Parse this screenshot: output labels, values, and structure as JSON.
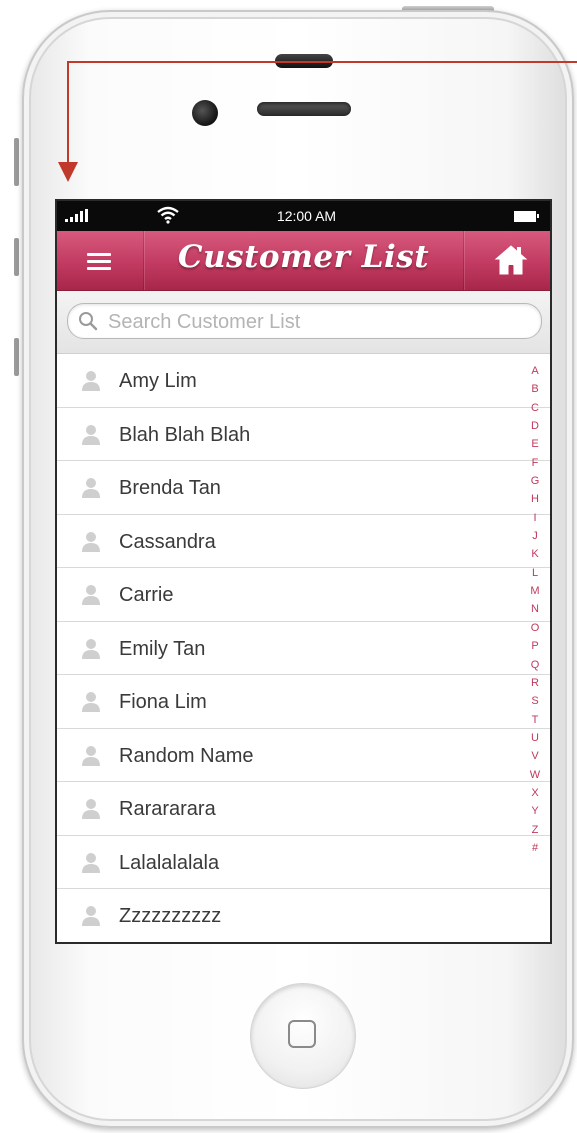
{
  "status_bar": {
    "time": "12:00 AM"
  },
  "navbar": {
    "title": "Customer List"
  },
  "search": {
    "placeholder": "Search Customer List",
    "value": ""
  },
  "customers": [
    "Amy Lim",
    "Blah Blah Blah",
    "Brenda Tan",
    "Cassandra",
    "Carrie",
    "Emily Tan",
    "Fiona Lim",
    "Random Name",
    "Rarararara",
    "Lalalalalala",
    "Zzzzzzzzzz"
  ],
  "index_letters": [
    "A",
    "B",
    "C",
    "D",
    "E",
    "F",
    "G",
    "H",
    "I",
    "J",
    "K",
    "L",
    "M",
    "N",
    "O",
    "P",
    "Q",
    "R",
    "S",
    "T",
    "U",
    "V",
    "W",
    "X",
    "Y",
    "Z",
    "#"
  ],
  "colors": {
    "accent": "#c23a61",
    "index_letter": "#c0395d",
    "annotation": "#c0392b"
  },
  "icons": {
    "menu": "menu-icon",
    "home": "home-icon",
    "search": "search-icon",
    "person": "person-icon"
  }
}
